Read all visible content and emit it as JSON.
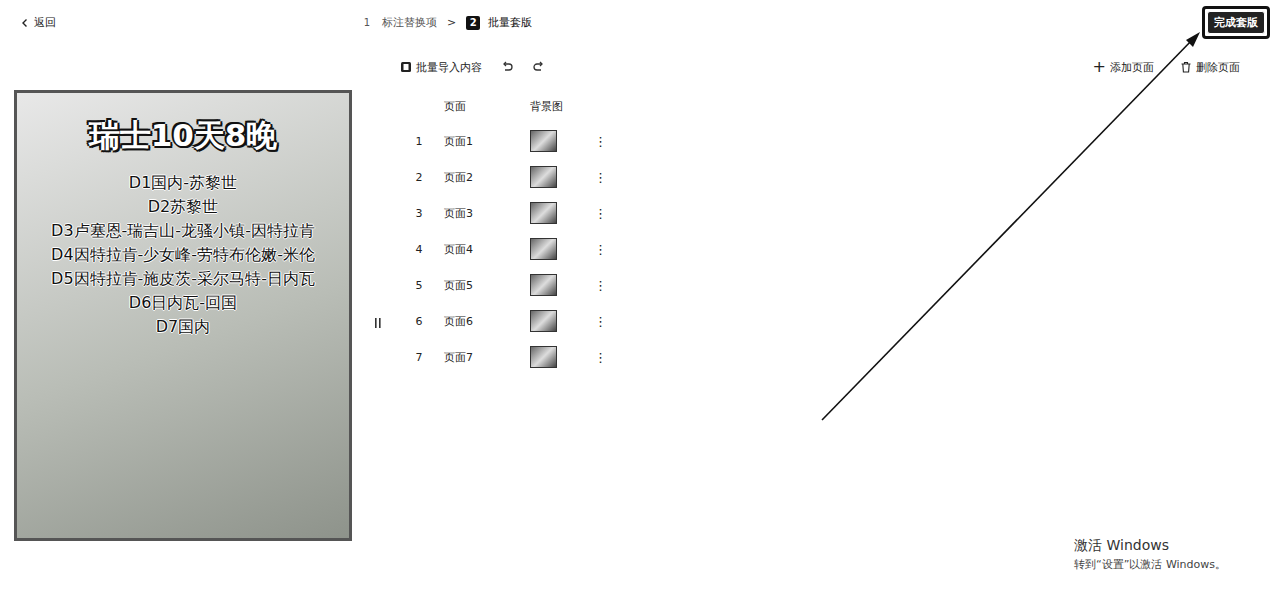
{
  "header": {
    "back": "返回",
    "steps": [
      {
        "number": "1",
        "label": "标注替换项",
        "selected": false
      },
      {
        "number": "2",
        "label": "批量套版",
        "selected": true
      }
    ],
    "step_separator": ">",
    "finish_button": {
      "label": "完成套版",
      "highlighted": true
    }
  },
  "toolbar": {
    "import": "批量导入内容",
    "add": {
      "icon": "+",
      "label": "添加页面"
    },
    "delete": "删除页面"
  },
  "preview": {
    "title": "瑞士10天8晚",
    "lines": [
      "D1国内-苏黎世",
      "D2苏黎世",
      "D3卢塞恩-瑞吉山-龙骚小镇-因特拉肯",
      "D4因特拉肯-少女峰-劳特布伦嫩-米伦",
      "D5因特拉肯-施皮茨-采尔马特-日内瓦",
      "D6日内瓦-回国",
      "D7国内"
    ]
  },
  "table": {
    "columns": [
      "页面",
      "背景图"
    ],
    "rows": [
      {
        "index": "1",
        "name": "页面1",
        "menu": "⋮"
      },
      {
        "index": "2",
        "name": "页面2",
        "menu": "⋮"
      },
      {
        "index": "3",
        "name": "页面3",
        "menu": "⋮"
      },
      {
        "index": "4",
        "name": "页面4",
        "menu": "⋮"
      },
      {
        "index": "5",
        "name": "页面5",
        "menu": "⋮"
      },
      {
        "index": "6",
        "name": "页面6",
        "menu": "⋮"
      },
      {
        "index": "7",
        "name": "页面7",
        "menu": "⋮"
      }
    ]
  },
  "watermark": {
    "title": "激活 Windows",
    "subtitle": "转到“设置”以激活 Windows。"
  }
}
